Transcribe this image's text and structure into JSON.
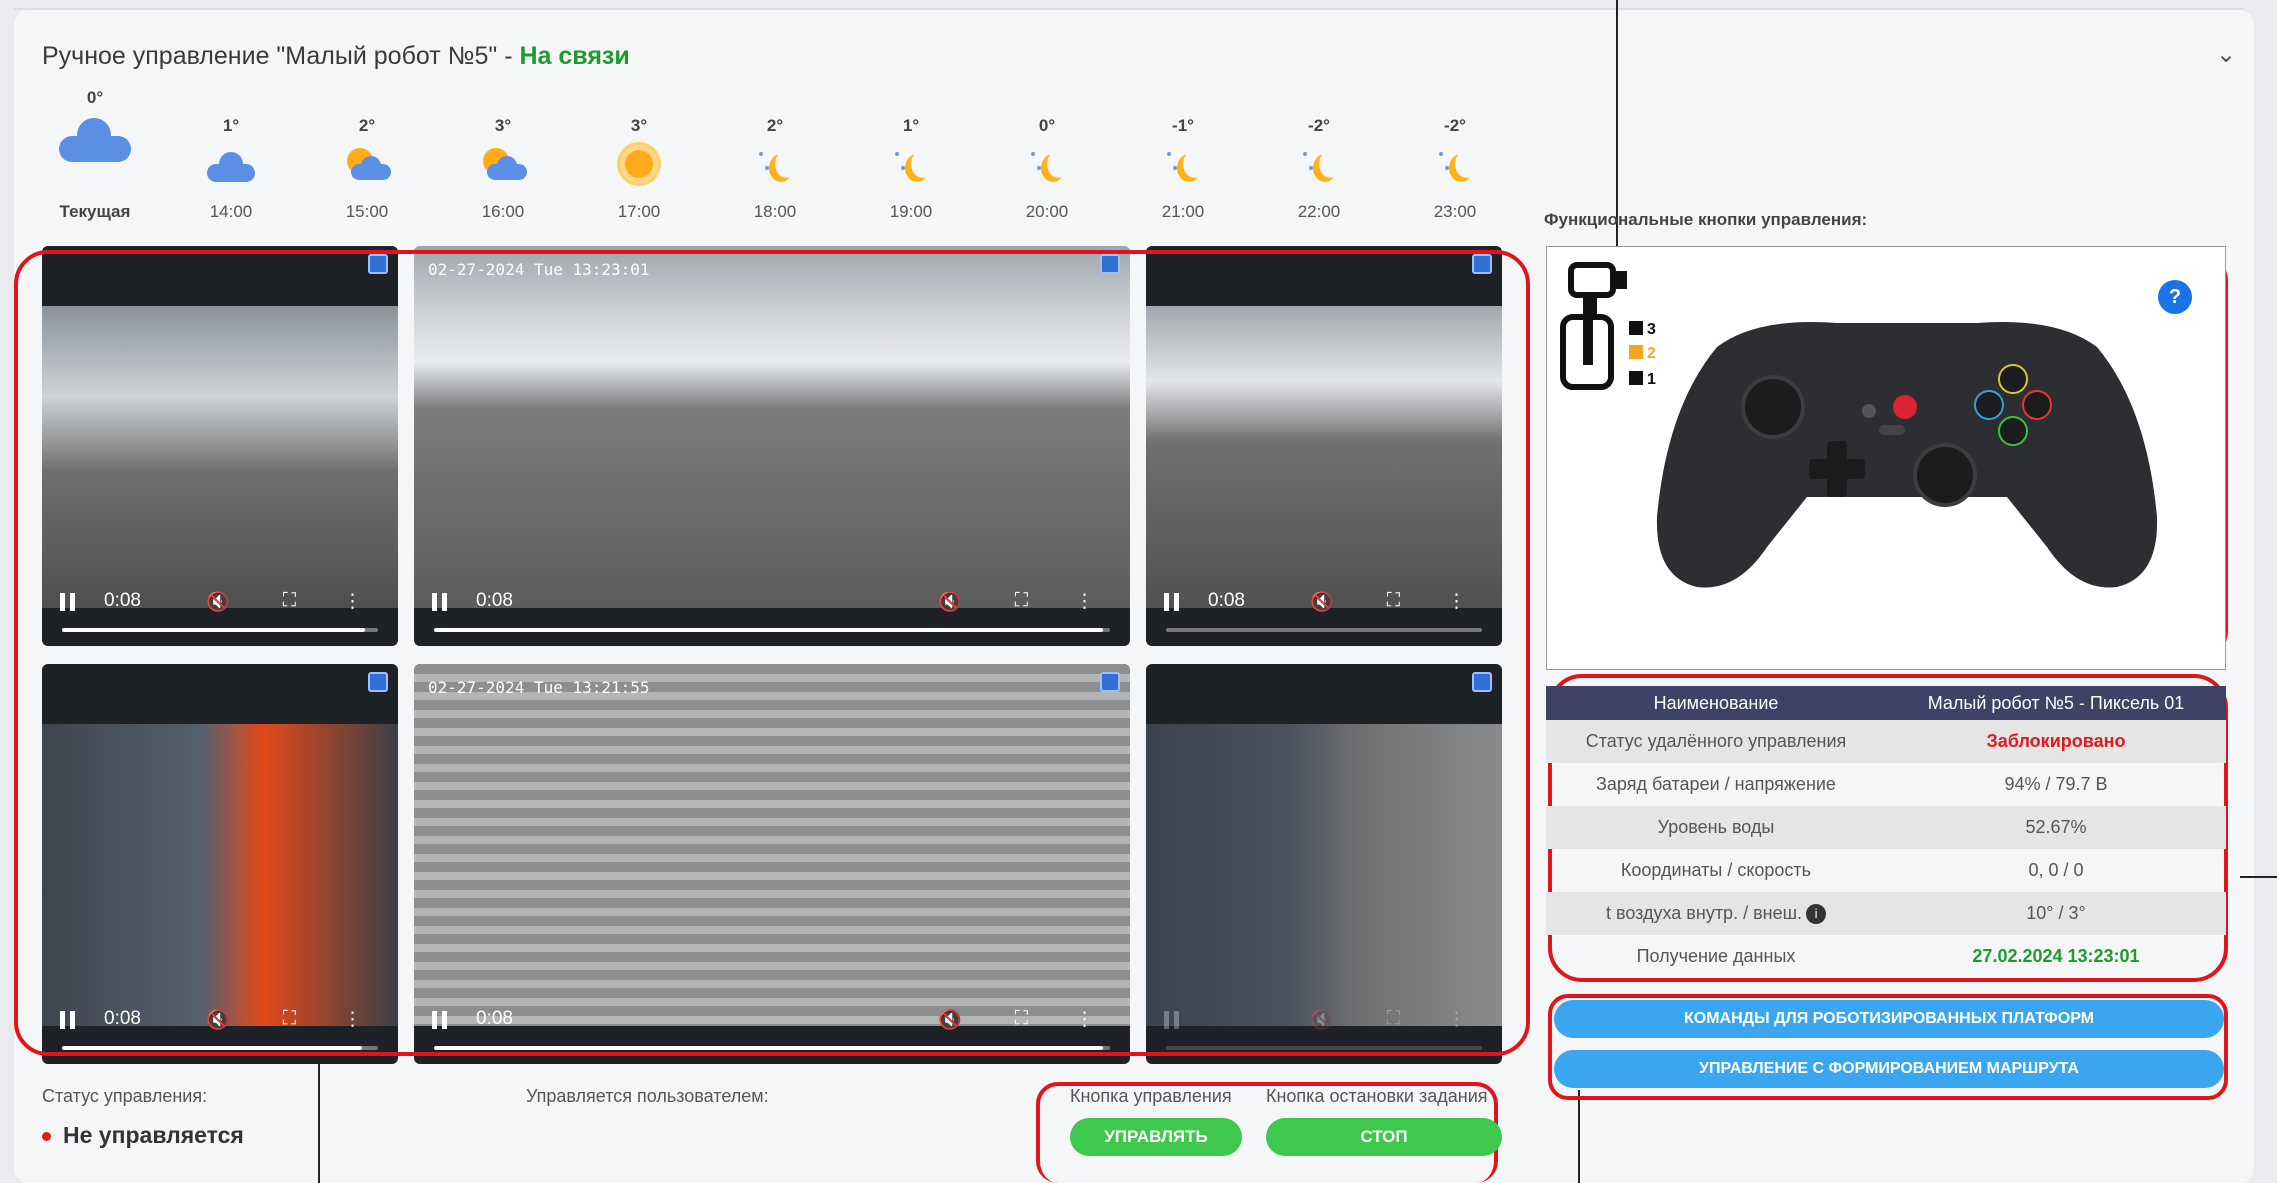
{
  "header": {
    "title_prefix": "Ручное управление \"Малый робот №5\" - ",
    "status": "На связи",
    "collapse_icon": "chevron-down-icon"
  },
  "weather": [
    {
      "temp": "0°",
      "time": "Текущая",
      "icon": "cloud"
    },
    {
      "temp": "1°",
      "time": "14:00",
      "icon": "cloud"
    },
    {
      "temp": "2°",
      "time": "15:00",
      "icon": "partly-sunny"
    },
    {
      "temp": "3°",
      "time": "16:00",
      "icon": "partly-sunny"
    },
    {
      "temp": "3°",
      "time": "17:00",
      "icon": "sun"
    },
    {
      "temp": "2°",
      "time": "18:00",
      "icon": "moon"
    },
    {
      "temp": "1°",
      "time": "19:00",
      "icon": "moon"
    },
    {
      "temp": "0°",
      "time": "20:00",
      "icon": "moon"
    },
    {
      "temp": "-1°",
      "time": "21:00",
      "icon": "moon"
    },
    {
      "temp": "-2°",
      "time": "22:00",
      "icon": "moon"
    },
    {
      "temp": "-2°",
      "time": "23:00",
      "icon": "moon"
    }
  ],
  "videos": [
    {
      "timestamp": "",
      "time": "0:08",
      "progress": 0.96
    },
    {
      "timestamp": "02-27-2024 Tue 13:23:01",
      "time": "0:08",
      "progress": 0.99
    },
    {
      "timestamp": "",
      "time": "0:08",
      "progress": 0.0
    },
    {
      "timestamp": "",
      "time": "0:08",
      "progress": 0.95
    },
    {
      "timestamp": "02-27-2024 Tue 13:21:55",
      "time": "0:08",
      "progress": 0.99
    },
    {
      "timestamp": "",
      "time": "",
      "progress": 0.0
    }
  ],
  "bottom": {
    "status_label": "Статус управления:",
    "status_value": "Не управляется",
    "user_label": "Управляется пользователем:",
    "control_button_label": "Кнопка управления",
    "stop_button_label": "Кнопка остановки задания",
    "control_button": "УПРАВЛЯТЬ",
    "stop_button": "СТОП"
  },
  "right": {
    "func_title": "Функциональные кнопки управления:",
    "help": "?",
    "gear_levels": [
      "3",
      "2",
      "1"
    ],
    "table_header": [
      "Наименование",
      "Малый робот №5 - Пиксель 01"
    ],
    "rows": [
      {
        "label": "Статус удалённого управления",
        "value": "Заблокировано",
        "style": "red"
      },
      {
        "label": "Заряд батареи / напряжение",
        "value": "94% / 79.7 В",
        "style": ""
      },
      {
        "label": "Уровень воды",
        "value": "52.67%",
        "style": ""
      },
      {
        "label": "Координаты / скорость",
        "value": "0, 0 / 0",
        "style": ""
      },
      {
        "label": "t воздуха внутр. / внеш.",
        "value": "10° / 3°",
        "style": ""
      },
      {
        "label": "Получение данных",
        "value": "27.02.2024 13:23:01",
        "style": "green"
      }
    ],
    "buttons": [
      "КОМАНДЫ ДЛЯ РОБОТИЗИРОВАННЫХ ПЛАТФОРМ",
      "УПРАВЛЕНИЕ С ФОРМИРОВАНИЕМ МАРШРУТА"
    ]
  },
  "colors": {
    "accent_red": "#e0141b",
    "online_green": "#1f9a2e",
    "button_blue": "#3aa6f0",
    "button_green": "#3ec84e"
  }
}
